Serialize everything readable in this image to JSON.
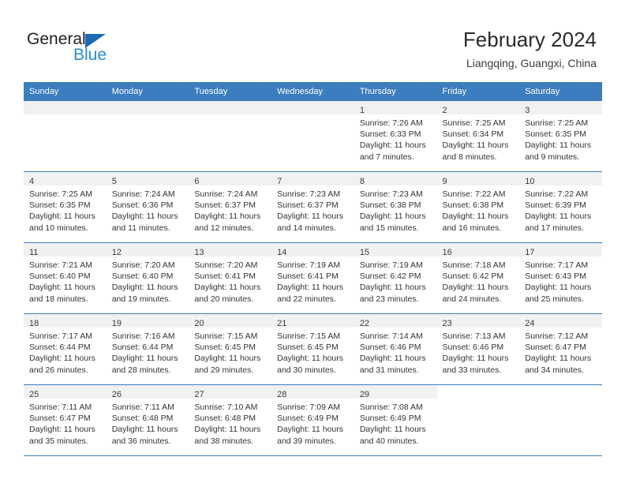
{
  "logo": {
    "text_top": "General",
    "text_bottom": "Blue",
    "triangle_icon": "blue-triangle-icon",
    "color_dark": "#231f20",
    "color_blue": "#2b8ad6"
  },
  "header": {
    "title": "February 2024",
    "subtitle": "Liangqing, Guangxi, China"
  },
  "theme": {
    "header_bg": "#3b7dbe",
    "header_text": "#ffffff",
    "daynum_bg": "#f1f1f1",
    "row_border": "#3b7dbe",
    "body_text": "#333333"
  },
  "weekdays": [
    "Sunday",
    "Monday",
    "Tuesday",
    "Wednesday",
    "Thursday",
    "Friday",
    "Saturday"
  ],
  "weeks": [
    [
      {
        "day": "",
        "empty": true
      },
      {
        "day": "",
        "empty": true
      },
      {
        "day": "",
        "empty": true
      },
      {
        "day": "",
        "empty": true
      },
      {
        "day": "1",
        "sunrise": "Sunrise: 7:26 AM",
        "sunset": "Sunset: 6:33 PM",
        "daylight1": "Daylight: 11 hours",
        "daylight2": "and 7 minutes."
      },
      {
        "day": "2",
        "sunrise": "Sunrise: 7:25 AM",
        "sunset": "Sunset: 6:34 PM",
        "daylight1": "Daylight: 11 hours",
        "daylight2": "and 8 minutes."
      },
      {
        "day": "3",
        "sunrise": "Sunrise: 7:25 AM",
        "sunset": "Sunset: 6:35 PM",
        "daylight1": "Daylight: 11 hours",
        "daylight2": "and 9 minutes."
      }
    ],
    [
      {
        "day": "4",
        "sunrise": "Sunrise: 7:25 AM",
        "sunset": "Sunset: 6:35 PM",
        "daylight1": "Daylight: 11 hours",
        "daylight2": "and 10 minutes."
      },
      {
        "day": "5",
        "sunrise": "Sunrise: 7:24 AM",
        "sunset": "Sunset: 6:36 PM",
        "daylight1": "Daylight: 11 hours",
        "daylight2": "and 11 minutes."
      },
      {
        "day": "6",
        "sunrise": "Sunrise: 7:24 AM",
        "sunset": "Sunset: 6:37 PM",
        "daylight1": "Daylight: 11 hours",
        "daylight2": "and 12 minutes."
      },
      {
        "day": "7",
        "sunrise": "Sunrise: 7:23 AM",
        "sunset": "Sunset: 6:37 PM",
        "daylight1": "Daylight: 11 hours",
        "daylight2": "and 14 minutes."
      },
      {
        "day": "8",
        "sunrise": "Sunrise: 7:23 AM",
        "sunset": "Sunset: 6:38 PM",
        "daylight1": "Daylight: 11 hours",
        "daylight2": "and 15 minutes."
      },
      {
        "day": "9",
        "sunrise": "Sunrise: 7:22 AM",
        "sunset": "Sunset: 6:38 PM",
        "daylight1": "Daylight: 11 hours",
        "daylight2": "and 16 minutes."
      },
      {
        "day": "10",
        "sunrise": "Sunrise: 7:22 AM",
        "sunset": "Sunset: 6:39 PM",
        "daylight1": "Daylight: 11 hours",
        "daylight2": "and 17 minutes."
      }
    ],
    [
      {
        "day": "11",
        "sunrise": "Sunrise: 7:21 AM",
        "sunset": "Sunset: 6:40 PM",
        "daylight1": "Daylight: 11 hours",
        "daylight2": "and 18 minutes."
      },
      {
        "day": "12",
        "sunrise": "Sunrise: 7:20 AM",
        "sunset": "Sunset: 6:40 PM",
        "daylight1": "Daylight: 11 hours",
        "daylight2": "and 19 minutes."
      },
      {
        "day": "13",
        "sunrise": "Sunrise: 7:20 AM",
        "sunset": "Sunset: 6:41 PM",
        "daylight1": "Daylight: 11 hours",
        "daylight2": "and 20 minutes."
      },
      {
        "day": "14",
        "sunrise": "Sunrise: 7:19 AM",
        "sunset": "Sunset: 6:41 PM",
        "daylight1": "Daylight: 11 hours",
        "daylight2": "and 22 minutes."
      },
      {
        "day": "15",
        "sunrise": "Sunrise: 7:19 AM",
        "sunset": "Sunset: 6:42 PM",
        "daylight1": "Daylight: 11 hours",
        "daylight2": "and 23 minutes."
      },
      {
        "day": "16",
        "sunrise": "Sunrise: 7:18 AM",
        "sunset": "Sunset: 6:42 PM",
        "daylight1": "Daylight: 11 hours",
        "daylight2": "and 24 minutes."
      },
      {
        "day": "17",
        "sunrise": "Sunrise: 7:17 AM",
        "sunset": "Sunset: 6:43 PM",
        "daylight1": "Daylight: 11 hours",
        "daylight2": "and 25 minutes."
      }
    ],
    [
      {
        "day": "18",
        "sunrise": "Sunrise: 7:17 AM",
        "sunset": "Sunset: 6:44 PM",
        "daylight1": "Daylight: 11 hours",
        "daylight2": "and 26 minutes."
      },
      {
        "day": "19",
        "sunrise": "Sunrise: 7:16 AM",
        "sunset": "Sunset: 6:44 PM",
        "daylight1": "Daylight: 11 hours",
        "daylight2": "and 28 minutes."
      },
      {
        "day": "20",
        "sunrise": "Sunrise: 7:15 AM",
        "sunset": "Sunset: 6:45 PM",
        "daylight1": "Daylight: 11 hours",
        "daylight2": "and 29 minutes."
      },
      {
        "day": "21",
        "sunrise": "Sunrise: 7:15 AM",
        "sunset": "Sunset: 6:45 PM",
        "daylight1": "Daylight: 11 hours",
        "daylight2": "and 30 minutes."
      },
      {
        "day": "22",
        "sunrise": "Sunrise: 7:14 AM",
        "sunset": "Sunset: 6:46 PM",
        "daylight1": "Daylight: 11 hours",
        "daylight2": "and 31 minutes."
      },
      {
        "day": "23",
        "sunrise": "Sunrise: 7:13 AM",
        "sunset": "Sunset: 6:46 PM",
        "daylight1": "Daylight: 11 hours",
        "daylight2": "and 33 minutes."
      },
      {
        "day": "24",
        "sunrise": "Sunrise: 7:12 AM",
        "sunset": "Sunset: 6:47 PM",
        "daylight1": "Daylight: 11 hours",
        "daylight2": "and 34 minutes."
      }
    ],
    [
      {
        "day": "25",
        "sunrise": "Sunrise: 7:11 AM",
        "sunset": "Sunset: 6:47 PM",
        "daylight1": "Daylight: 11 hours",
        "daylight2": "and 35 minutes."
      },
      {
        "day": "26",
        "sunrise": "Sunrise: 7:11 AM",
        "sunset": "Sunset: 6:48 PM",
        "daylight1": "Daylight: 11 hours",
        "daylight2": "and 36 minutes."
      },
      {
        "day": "27",
        "sunrise": "Sunrise: 7:10 AM",
        "sunset": "Sunset: 6:48 PM",
        "daylight1": "Daylight: 11 hours",
        "daylight2": "and 38 minutes."
      },
      {
        "day": "28",
        "sunrise": "Sunrise: 7:09 AM",
        "sunset": "Sunset: 6:49 PM",
        "daylight1": "Daylight: 11 hours",
        "daylight2": "and 39 minutes."
      },
      {
        "day": "29",
        "sunrise": "Sunrise: 7:08 AM",
        "sunset": "Sunset: 6:49 PM",
        "daylight1": "Daylight: 11 hours",
        "daylight2": "and 40 minutes."
      },
      {
        "day": "",
        "empty": true
      },
      {
        "day": "",
        "empty": true
      }
    ]
  ]
}
